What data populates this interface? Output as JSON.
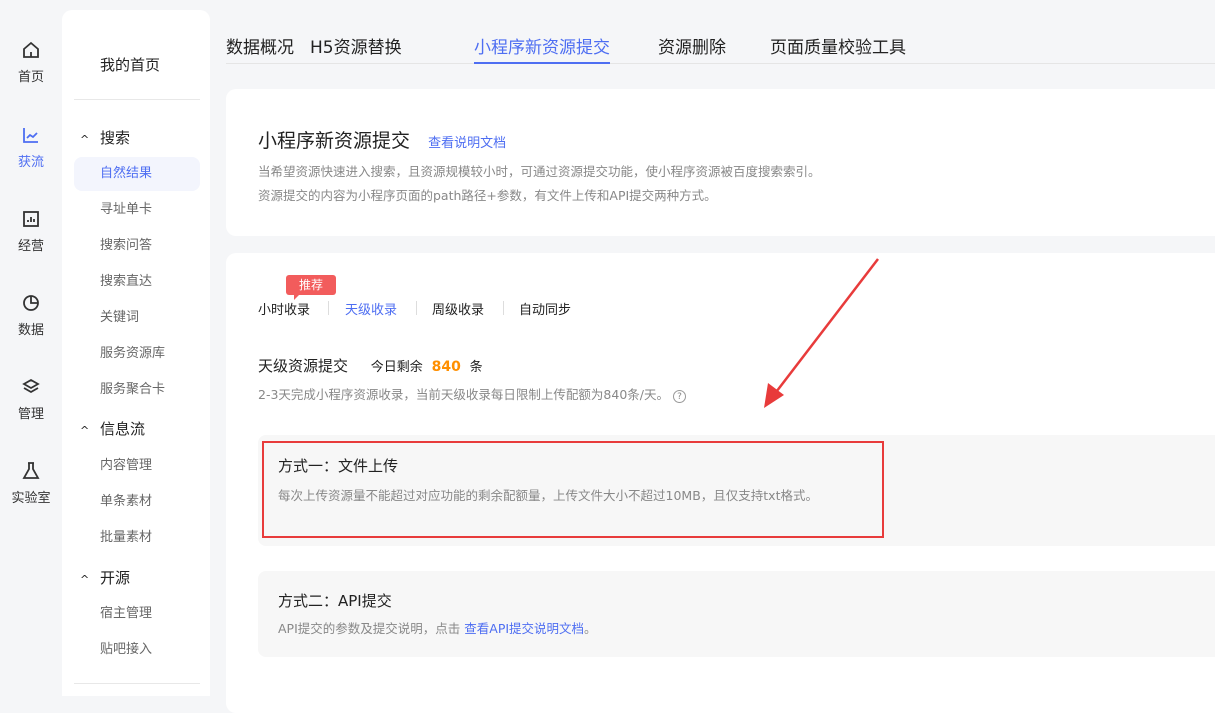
{
  "rail": [
    {
      "label": "首页",
      "icon": "home-icon"
    },
    {
      "label": "获流",
      "icon": "trend-chart-icon",
      "active": true
    },
    {
      "label": "经营",
      "icon": "bar-chart-icon"
    },
    {
      "label": "数据",
      "icon": "pie-chart-icon"
    },
    {
      "label": "管理",
      "icon": "layers-icon"
    },
    {
      "label": "实验室",
      "icon": "flask-icon"
    }
  ],
  "sidebar": {
    "home": "我的首页",
    "groups": [
      {
        "label": "搜索",
        "items": [
          "自然结果",
          "寻址单卡",
          "搜索问答",
          "搜索直达",
          "关键词",
          "服务资源库",
          "服务聚合卡"
        ]
      },
      {
        "label": "信息流",
        "items": [
          "内容管理",
          "单条素材",
          "批量素材"
        ]
      },
      {
        "label": "开源",
        "items": [
          "宿主管理",
          "贴吧接入"
        ]
      }
    ]
  },
  "tabs": [
    "数据概况",
    "H5资源替换",
    "小程序新资源提交",
    "资源删除",
    "页面质量校验工具"
  ],
  "intro": {
    "title": "小程序新资源提交",
    "doc_link": "查看说明文档",
    "line1": "当希望资源快速进入搜索，且资源规模较小时，可通过资源提交功能，使小程序资源被百度搜索索引。",
    "line2": "资源提交的内容为小程序页面的path路径+参数，有文件上传和API提交两种方式。"
  },
  "submit": {
    "badge": "推荐",
    "subtabs": [
      "小时收录",
      "天级收录",
      "周级收录",
      "自动同步"
    ],
    "section_title": "天级资源提交",
    "remaining_prefix": "今日剩余",
    "remaining": "840",
    "remaining_suffix": "条",
    "note": "2-3天完成小程序资源收录，当前天级收录每日限制上传配额为840条/天。",
    "method1": {
      "title": "方式一：文件上传",
      "desc": "每次上传资源量不能超过对应功能的剩余配额量，上传文件大小不超过10MB，且仅支持txt格式。"
    },
    "method2": {
      "title": "方式二：API提交",
      "desc": "API提交的参数及提交说明，点击",
      "link": "查看API提交说明文档",
      "end": "。"
    }
  },
  "colors": {
    "accent": "#4e6ef2",
    "orange": "#ff8f00",
    "annotation": "#e83b3b"
  }
}
